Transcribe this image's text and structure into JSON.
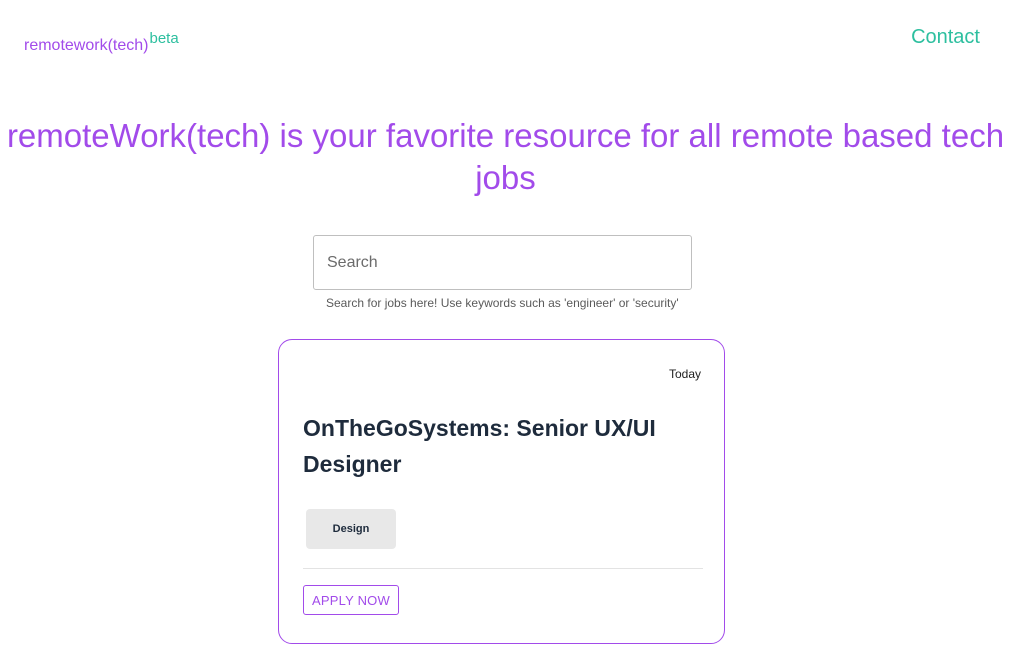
{
  "header": {
    "logo": "remotework(tech)",
    "logo_badge": "beta",
    "contact_label": "Contact"
  },
  "hero": {
    "headline": "remoteWork(tech) is your favorite resource for all remote based tech jobs"
  },
  "search": {
    "placeholder": "Search",
    "value": "",
    "help_text": "Search for jobs here! Use keywords such as 'engineer' or 'security'"
  },
  "jobs": [
    {
      "date": "Today",
      "title": "OnTheGoSystems: Senior UX/UI Designer",
      "tag": "Design",
      "apply_label": "APPLY NOW"
    }
  ],
  "colors": {
    "brand_purple": "#a24bea",
    "accent_teal": "#2dbf9f",
    "title_navy": "#1e2b3c",
    "tag_bg": "#e8e8e8"
  }
}
